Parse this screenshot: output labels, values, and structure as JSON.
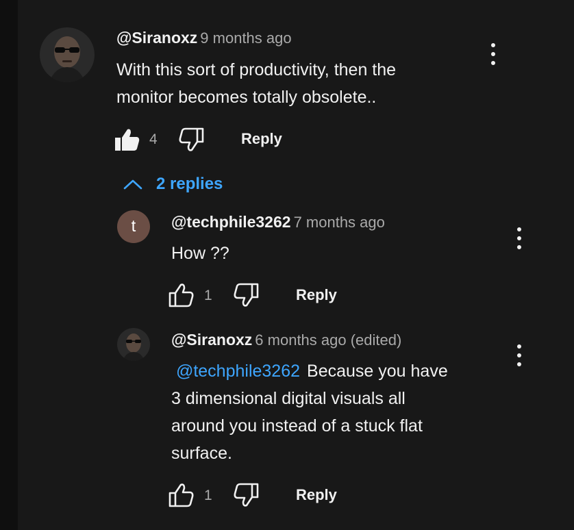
{
  "comments": {
    "top": {
      "author": "@Siranoxz",
      "time": "9 months ago",
      "text_line1": "With this sort of productivity, then the",
      "text_line2": "monitor becomes totally obsolete..",
      "likes": "4",
      "reply_label": "Reply",
      "liked": true
    },
    "replies_toggle": "2 replies",
    "reply1": {
      "avatar_initial": "t",
      "author": "@techphile3262",
      "time": "7 months ago",
      "text": "How ??",
      "likes": "1",
      "reply_label": "Reply"
    },
    "reply2": {
      "author": "@Siranoxz",
      "time": "6 months ago (edited)",
      "mention": "@techphile3262",
      "text_line1": "Because you have",
      "text_line2": "3 dimensional digital visuals all",
      "text_line3": "around you instead of a stuck flat",
      "text_line4": "surface.",
      "likes": "1",
      "reply_label": "Reply"
    }
  },
  "colors": {
    "background": "#181818",
    "link": "#3ea6ff",
    "secondary_text": "#aaaaaa",
    "avatar_initial_bg": "#6b4e45"
  },
  "icons": [
    "thumb-up-icon",
    "thumb-down-icon",
    "chevron-up-icon",
    "more-vert-icon"
  ]
}
